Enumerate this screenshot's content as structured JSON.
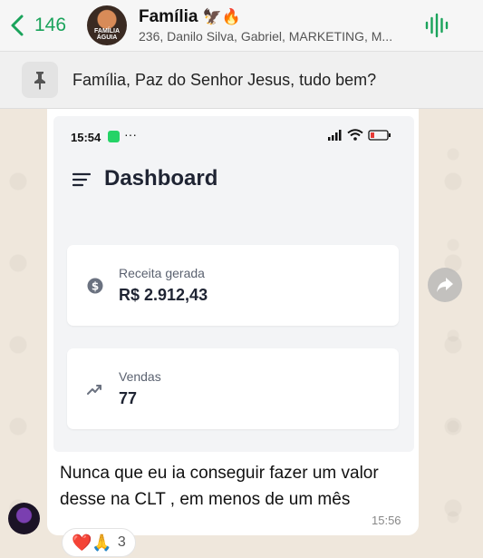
{
  "header": {
    "back_count": "146",
    "title": "Família",
    "title_emojis": "🦅🔥",
    "subtitle": "236, Danilo Silva, Gabriel, MARKETING, M...",
    "avatar_text": "FAMÍLIA ÁGUIA",
    "accent_color": "#1aa35b"
  },
  "pinned": {
    "icon": "pin-icon",
    "text": "Família, Paz do Senhor Jesus, tudo bem?"
  },
  "message": {
    "screenshot": {
      "status_time": "15:54",
      "status_dots": "···",
      "title": "Dashboard",
      "cards": [
        {
          "icon": "dollar-icon",
          "label": "Receita gerada",
          "value": "R$ 2.912,43"
        },
        {
          "icon": "trend-up-icon",
          "label": "Vendas",
          "value": "77"
        }
      ]
    },
    "text": "Nunca que eu ia conseguir fazer um valor desse na CLT , em menos de um mês",
    "time": "15:56",
    "reactions": {
      "emojis": "❤️🙏",
      "count": "3"
    }
  }
}
